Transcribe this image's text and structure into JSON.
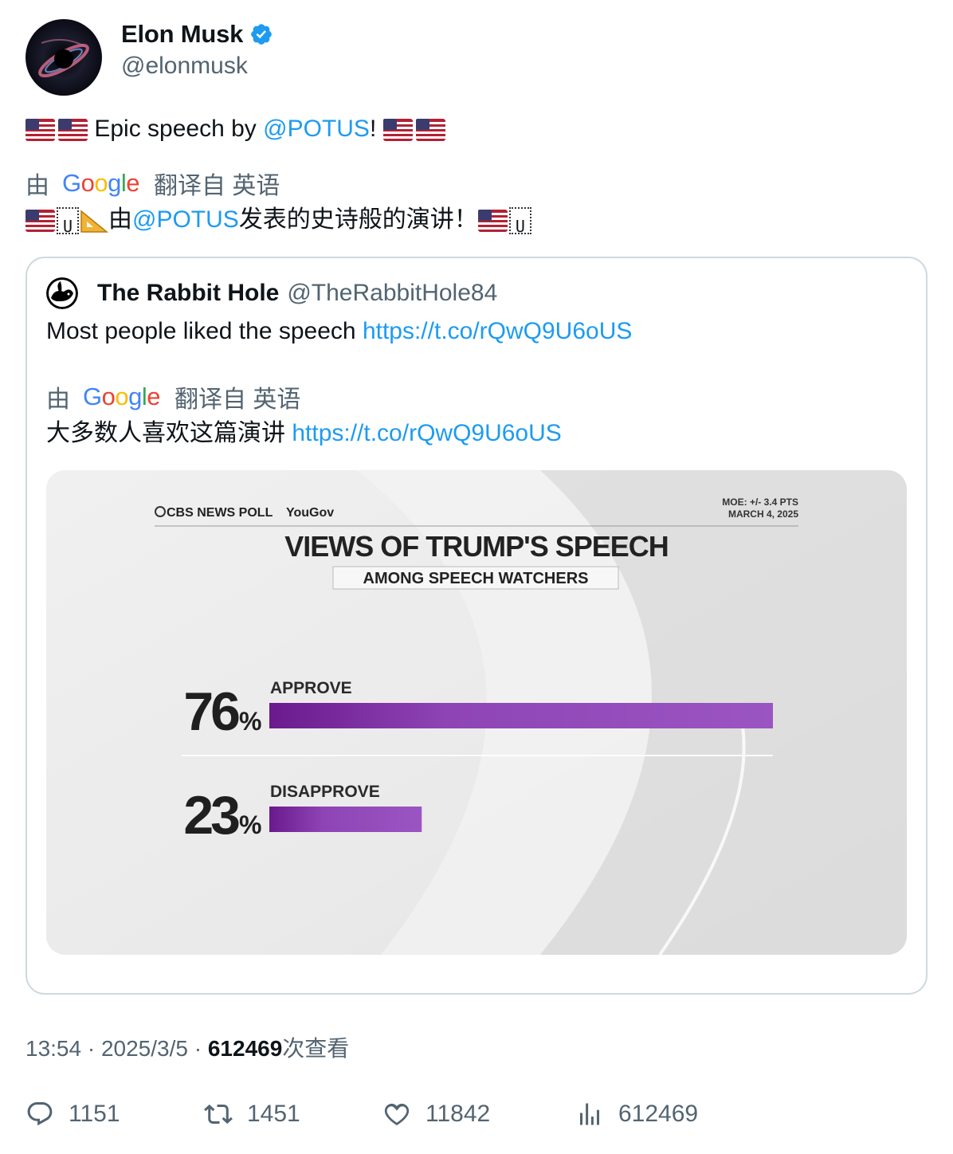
{
  "tweet": {
    "author_name": "Elon Musk",
    "author_handle": "@elonmusk",
    "text_prefix": "Epic speech by",
    "mention": "@POTUS",
    "text_suffix": "!",
    "translate_by": "由",
    "translate_brand": "Google",
    "translate_from": "翻译自 英语",
    "translated_prefix": "由",
    "translated_mention": "@POTUS",
    "translated_suffix": "发表的史诗般的演讲！"
  },
  "quoted": {
    "author_name": "The Rabbit Hole",
    "author_handle": "@TheRabbitHole84",
    "text": "Most people liked the speech",
    "link": "https://t.co/rQwQ9U6oUS",
    "translate_by": "由",
    "translate_brand": "Google",
    "translate_from": "翻译自 英语",
    "translated_text": "大多数人喜欢这篇演讲",
    "translated_link": "https://t.co/rQwQ9U6oUS"
  },
  "chart_data": {
    "type": "bar",
    "source": "CBS NEWS POLL",
    "partner": "YouGov",
    "moe": "MOE: +/- 3.4 PTS",
    "date": "MARCH 4, 2025",
    "title": "VIEWS OF TRUMP'S SPEECH",
    "subtitle": "AMONG SPEECH WATCHERS",
    "categories": [
      "APPROVE",
      "DISAPPROVE"
    ],
    "values": [
      76,
      23
    ],
    "value_labels": [
      "76",
      "23"
    ],
    "unit": "%",
    "bar_color": "#8e44b5",
    "xlim": [
      0,
      76
    ]
  },
  "footer": {
    "time": "13:54",
    "date": "2025/3/5",
    "views": "612469",
    "views_label": "次查看"
  },
  "actions": {
    "replies": "1151",
    "retweets": "1451",
    "likes": "11842",
    "views": "612469"
  }
}
